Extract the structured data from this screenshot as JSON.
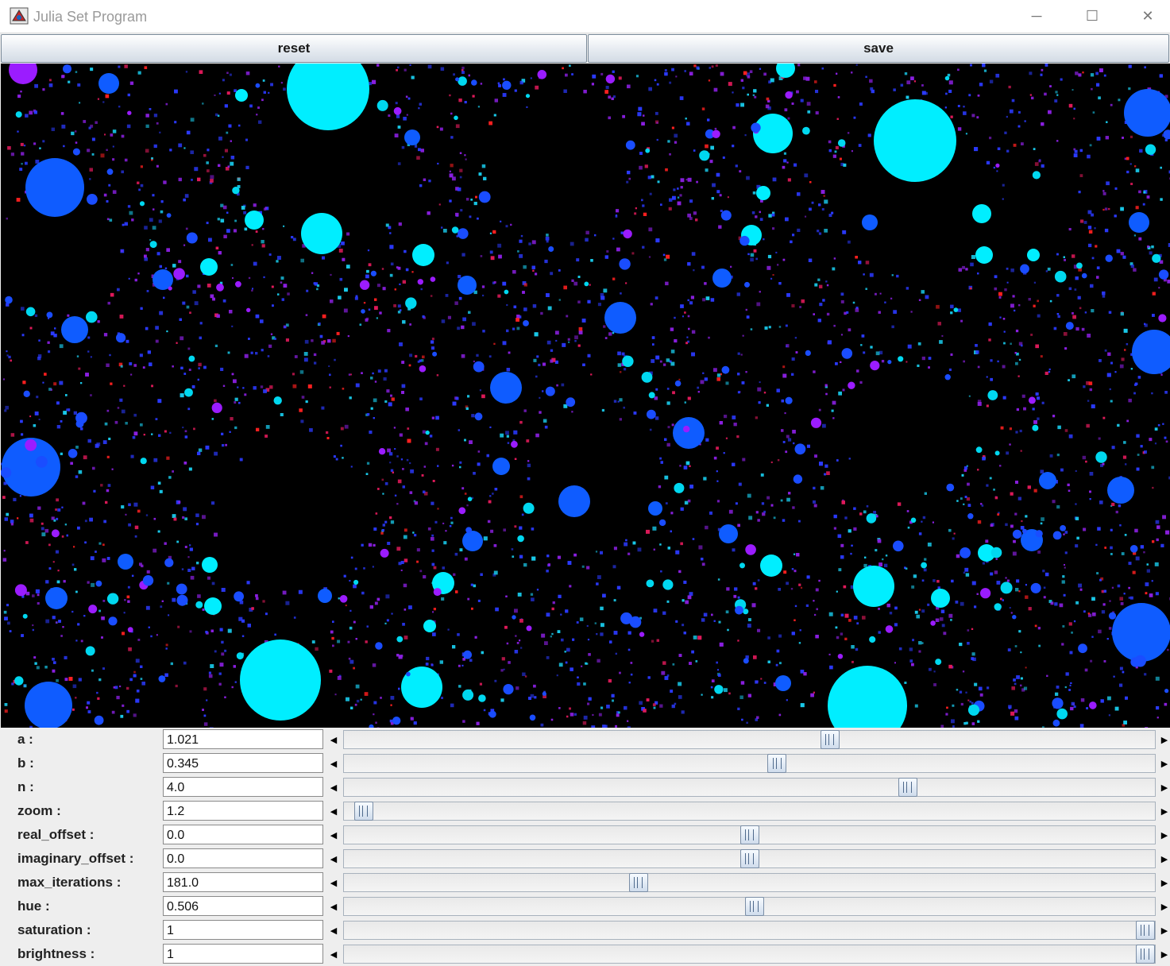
{
  "window": {
    "title": "Julia Set Program",
    "minimize_glyph": "─",
    "maximize_glyph": "☐",
    "close_glyph": "✕",
    "icon": "java-app-icon"
  },
  "toolbar": {
    "reset_label": "reset",
    "save_label": "save"
  },
  "fractal": {
    "description_colors": [
      "#000000",
      "#00eeff",
      "#0f5cff",
      "#9b1cff",
      "#ff1a33"
    ],
    "icon": "julia-set-image"
  },
  "controls": [
    {
      "label": "a :",
      "value": "1.021",
      "slider_fraction": 0.599
    },
    {
      "label": "b :",
      "value": "0.345",
      "slider_fraction": 0.534
    },
    {
      "label": "n :",
      "value": "4.0",
      "slider_fraction": 0.695
    },
    {
      "label": "zoom :",
      "value": "1.2",
      "slider_fraction": 0.024
    },
    {
      "label": "real_offset :",
      "value": "0.0",
      "slider_fraction": 0.5
    },
    {
      "label": "imaginary_offset :",
      "value": "0.0",
      "slider_fraction": 0.5
    },
    {
      "label": "max_iterations :",
      "value": "181.0",
      "slider_fraction": 0.363
    },
    {
      "label": "hue :",
      "value": "0.506",
      "slider_fraction": 0.506
    },
    {
      "label": "saturation :",
      "value": "1",
      "slider_fraction": 0.988
    },
    {
      "label": "brightness :",
      "value": "1",
      "slider_fraction": 0.988
    }
  ],
  "arrows": {
    "left_glyph": "◀",
    "right_glyph": "▶"
  }
}
